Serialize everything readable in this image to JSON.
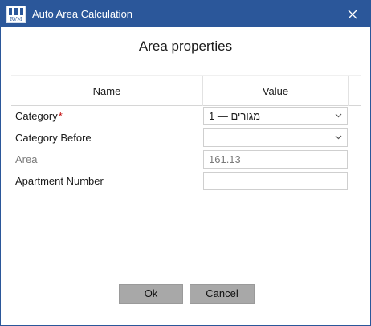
{
  "window": {
    "title": "Auto Area Calculation",
    "logo_text": "RVM"
  },
  "dialog": {
    "heading": "Area properties"
  },
  "grid": {
    "columns": {
      "name": "Name",
      "value": "Value"
    },
    "rows": [
      {
        "label": "Category",
        "required_mark": "*",
        "value": "1 — מגורים",
        "kind": "dropdown"
      },
      {
        "label": "Category Before",
        "value": "",
        "kind": "dropdown"
      },
      {
        "label": "Area",
        "value": "161.13",
        "kind": "readonly"
      },
      {
        "label": "Apartment Number",
        "value": "",
        "kind": "text"
      }
    ]
  },
  "buttons": {
    "ok": "Ok",
    "cancel": "Cancel"
  },
  "colors": {
    "titlebar": "#2b579a",
    "button_bg": "#a8a8a8",
    "required": "#c00000"
  },
  "icons": {
    "close": "close-icon",
    "dropdown": "chevron-down-icon",
    "logo": "app-logo-icon"
  }
}
